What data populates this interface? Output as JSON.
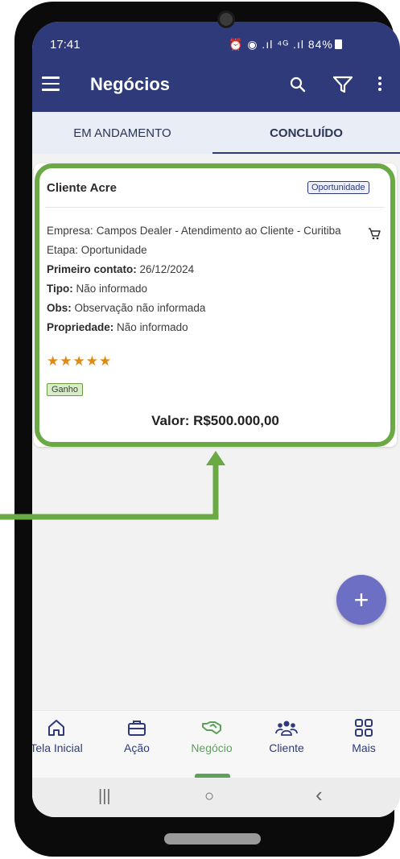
{
  "status_bar": {
    "time": "17:41",
    "icons": "⏰ ◉ .ıl ⁴ᴳ .ıl",
    "battery": "84%"
  },
  "app_bar": {
    "title": "Negócios"
  },
  "tabs": [
    {
      "label": "EM ANDAMENTO",
      "active": false
    },
    {
      "label": "CONCLUÍDO",
      "active": true
    }
  ],
  "deal": {
    "title": "Cliente Acre",
    "chip": "Oportunidade",
    "company_label": "Empresa:",
    "company_value": "Campos Dealer - Atendimento ao Cliente - Curitiba",
    "stage_label": "Etapa:",
    "stage_value": "Oportunidade",
    "first_contact_label": "Primeiro contato:",
    "first_contact_value": "26/12/2024",
    "type_label": "Tipo:",
    "type_value": "Não informado",
    "obs_label": "Obs:",
    "obs_value": "Observação não informada",
    "property_label": "Propriedade:",
    "property_value": "Não informado",
    "rating": 5,
    "stars": "★★★★★",
    "status_badge": "Ganho",
    "value_text": "Valor: R$500.000,00"
  },
  "fab": {
    "label": "+"
  },
  "bottom_nav": [
    {
      "label": "Tela Inicial",
      "icon": "home-icon"
    },
    {
      "label": "Ação",
      "icon": "briefcase-icon"
    },
    {
      "label": "Negócio",
      "icon": "handshake-icon",
      "active": true
    },
    {
      "label": "Cliente",
      "icon": "users-icon"
    },
    {
      "label": "Mais",
      "icon": "grid-icon"
    }
  ],
  "system_nav": {
    "recents": "|||",
    "home": "○",
    "back": "‹"
  },
  "colors": {
    "primary": "#2f3a7a",
    "highlight": "#6aa944",
    "accent": "#5aa15a",
    "fab": "#6d6fc4",
    "star": "#e08a14"
  }
}
